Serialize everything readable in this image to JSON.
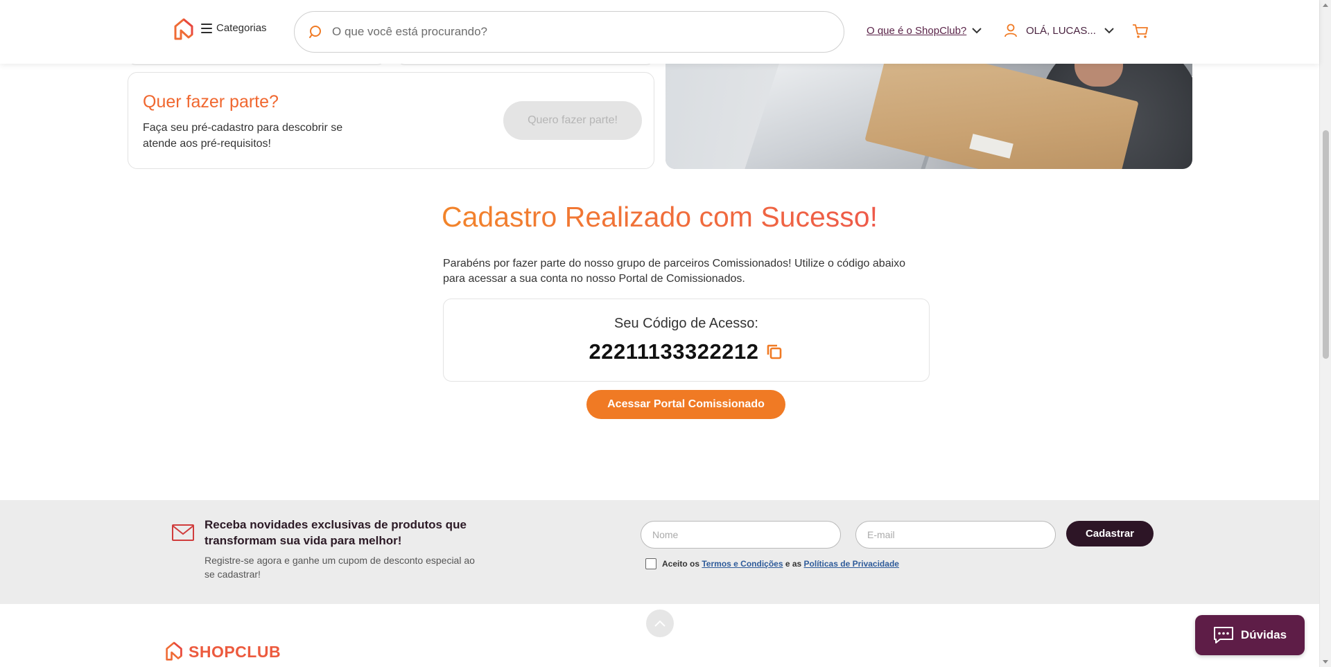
{
  "header": {
    "categories_label": "Categorias",
    "search_placeholder": "O que você está procurando?",
    "whatis_label": "O que é o ShopClub?",
    "user_label": "OLÁ, LUCAS..."
  },
  "join_card": {
    "title": "Quer fazer parte?",
    "description": "Faça seu pré-cadastro para descobrir se atende aos pré-requisitos!",
    "button_label": "Quero fazer parte!"
  },
  "success": {
    "title": "Cadastro Realizado com Sucesso!",
    "description": "Parabéns por fazer parte do nosso grupo de parceiros Comissionados! Utilize o código abaixo para acessar a sua conta no nosso Portal de Comissionados.",
    "code_label": "Seu Código de Acesso:",
    "code_value": "22211133322212",
    "portal_button": "Acessar Portal Comissionado"
  },
  "newsletter": {
    "title": "Receba novidades exclusivas de produtos que transformam sua vida para melhor!",
    "subtitle": "Registre-se agora e ganhe um cupom de desconto especial ao se cadastrar!",
    "name_placeholder": "Nome",
    "email_placeholder": "E-mail",
    "button_label": "Cadastrar",
    "terms_prefix": "Aceito os",
    "terms_link": "Termos e Condições",
    "terms_middle": "e as",
    "privacy_link": "Políticas de Privacidade"
  },
  "footer": {
    "brand": "SHOPCLUB",
    "help_button": "Dúvidas"
  },
  "colors": {
    "orange": "#f07a24",
    "coral": "#ee5a4a",
    "plum": "#5e1d47",
    "dark_plum": "#2d1526"
  },
  "icons": [
    "shopclub-logo-icon",
    "hamburger-icon",
    "search-icon",
    "chevron-down-icon",
    "user-icon",
    "cart-icon",
    "copy-icon",
    "mail-icon",
    "arrow-up-icon",
    "chat-icon"
  ]
}
